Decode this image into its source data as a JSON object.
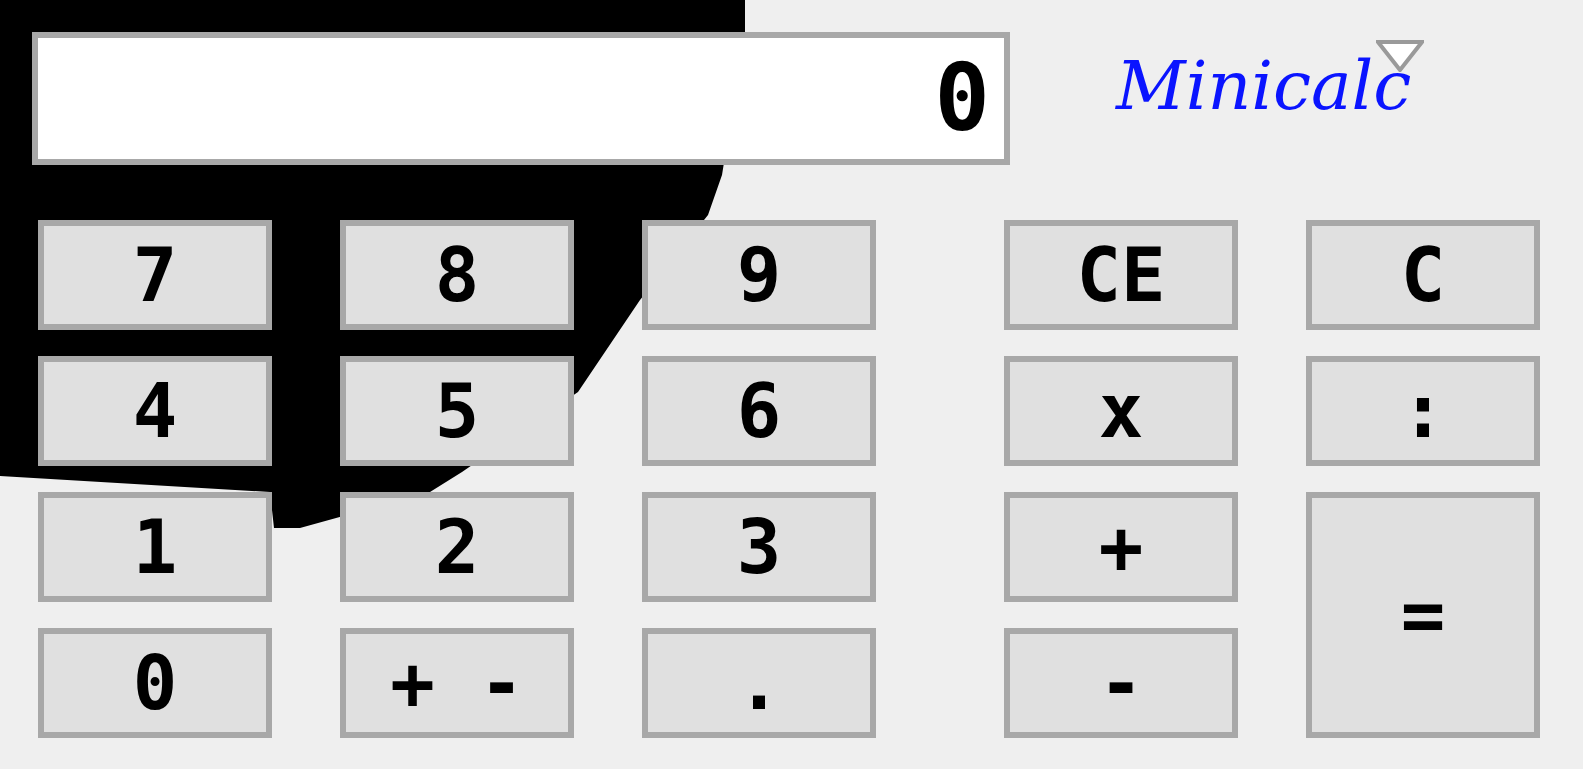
{
  "display": {
    "value": "0"
  },
  "logo": "Minicalc",
  "keypad": [
    [
      {
        "label": "7",
        "kind": "normal"
      },
      {
        "label": "8",
        "kind": "normal"
      },
      {
        "label": "9",
        "kind": "normal"
      },
      {
        "label": "CE",
        "kind": "normal"
      },
      {
        "label": "C",
        "kind": "normal"
      }
    ],
    [
      {
        "label": "4",
        "kind": "normal"
      },
      {
        "label": "5",
        "kind": "normal"
      },
      {
        "label": "6",
        "kind": "normal"
      },
      {
        "label": "x",
        "kind": "normal"
      },
      {
        "label": ":",
        "kind": "normal"
      }
    ],
    [
      {
        "label": "1",
        "kind": "normal"
      },
      {
        "label": "2",
        "kind": "normal"
      },
      {
        "label": "3",
        "kind": "normal"
      },
      {
        "label": "+",
        "kind": "normal"
      },
      {
        "label": "=",
        "kind": "tall"
      }
    ],
    [
      {
        "label": "0",
        "kind": "normal"
      },
      {
        "label": "+ -",
        "kind": "normal"
      },
      {
        "label": ".",
        "kind": "normal"
      },
      {
        "label": "-",
        "kind": "normal"
      }
    ]
  ]
}
